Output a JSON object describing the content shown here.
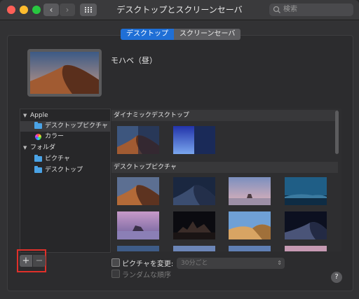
{
  "window": {
    "title": "デスクトップとスクリーンセーバ"
  },
  "search": {
    "placeholder": "検索"
  },
  "tabs": [
    {
      "label": "デスクトップ",
      "active": true
    },
    {
      "label": "スクリーンセーバ",
      "active": false
    }
  ],
  "current": {
    "name": "モハベ（昼）"
  },
  "sidebar": {
    "groups": [
      {
        "label": "Apple",
        "items": [
          {
            "label": "デスクトップピクチャ",
            "icon": "folder-icon",
            "selected": true
          },
          {
            "label": "カラー",
            "icon": "color-wheel-icon",
            "selected": false
          }
        ]
      },
      {
        "label": "フォルダ",
        "items": [
          {
            "label": "ピクチャ",
            "icon": "folder-icon",
            "selected": false
          },
          {
            "label": "デスクトップ",
            "icon": "folder-icon",
            "selected": false
          }
        ]
      }
    ]
  },
  "gallery": {
    "sections": [
      {
        "title": "ダイナミックデスクトップ"
      },
      {
        "title": "デスクトップピクチャ"
      }
    ]
  },
  "controls": {
    "add_label": "+",
    "remove_label": "−",
    "change_picture_label": "ピクチャを変更:",
    "interval_value": "30分ごと",
    "random_label": "ランダムな順序",
    "help_label": "?"
  },
  "colors": {
    "accent": "#1f6fd6",
    "highlight": "#e0302a"
  }
}
